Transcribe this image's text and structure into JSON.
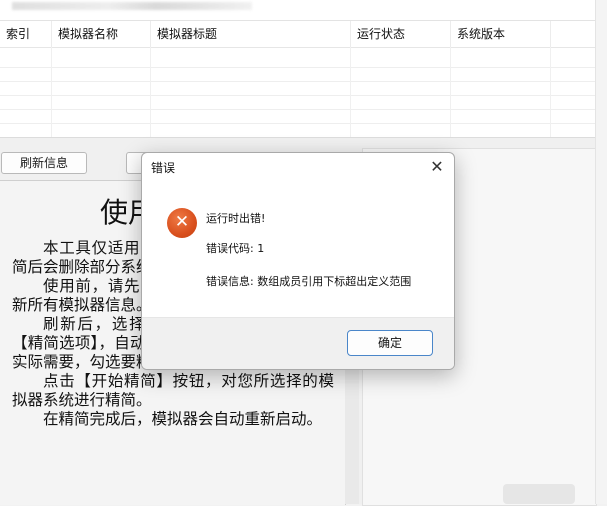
{
  "table": {
    "columns": [
      "索引",
      "模拟器名称",
      "模拟器标题",
      "运行状态",
      "系统版本"
    ]
  },
  "toolbar": {
    "refresh_label": "刷新信息"
  },
  "doc": {
    "title_visible": "使用",
    "paragraphs": [
      "本工具仅适用于模拟器系统精简使用，精简后会删除部分系统文件。",
      "使用前，请先点击【刷新信息】按钮，刷新所有模拟器信息。",
      "刷新后，选择需要精简的模拟器，点击【精简选项】，自动出现精简内容选项。请根据实际需要，勾选要精简的内容。",
      "点击【开始精简】按钮，对您所选择的模拟器系统进行精简。",
      "在精简完成后，模拟器会自动重新启动。"
    ]
  },
  "dialog": {
    "title": "错误",
    "close_glyph": "✕",
    "icon_glyph": "✕",
    "message_line1": "运行时出错!",
    "message_line2": "错误代码: 1",
    "message_line3": "错误信息: 数组成员引用下标超出定义范围",
    "ok_label": "确定"
  },
  "colors": {
    "error_icon": "#d9501e",
    "ok_border": "#4a86c9"
  }
}
